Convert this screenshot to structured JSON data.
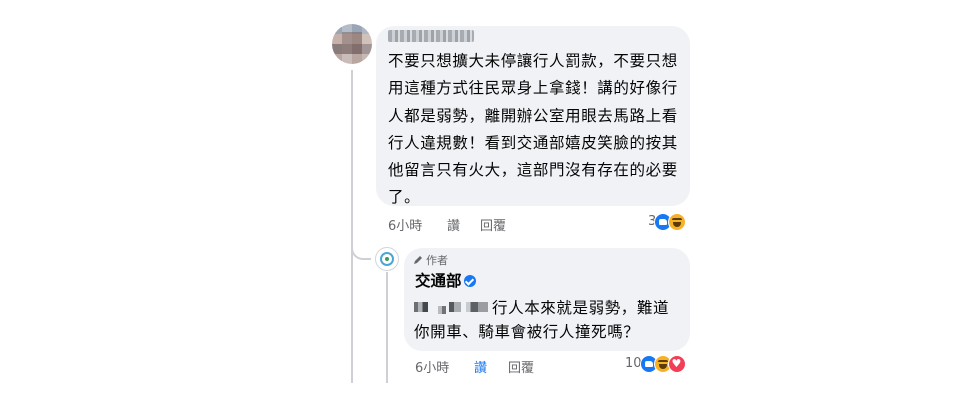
{
  "comment": {
    "text": "不要只想擴大未停讓行人罰款，不要只想用這種方式往民眾身上拿錢！講的好像行人都是弱勢，離開辦公室用眼去馬路上看行人違規數！看到交通部嬉皮笑臉的按其他留言只有火大，這部門沒有存在的必要了。",
    "time": "6小時",
    "like_label": "讚",
    "reply_label": "回覆",
    "reaction_count": "3",
    "reactions": [
      "like-icon",
      "haha-icon"
    ]
  },
  "reply": {
    "author_tag": "作者",
    "author_name": "交通部",
    "text_line1": "行人本來就是弱勢，難道",
    "text_line2": "你開車、騎車會被行人撞死嗎？",
    "time": "6小時",
    "like_label": "讚",
    "reply_label": "回覆",
    "reaction_count": "10",
    "reactions": [
      "like-icon",
      "haha-icon",
      "love-icon"
    ]
  },
  "colors": {
    "bubble": "#f0f2f5",
    "meta_text": "#65676b",
    "accent_blue": "#1877f2"
  }
}
